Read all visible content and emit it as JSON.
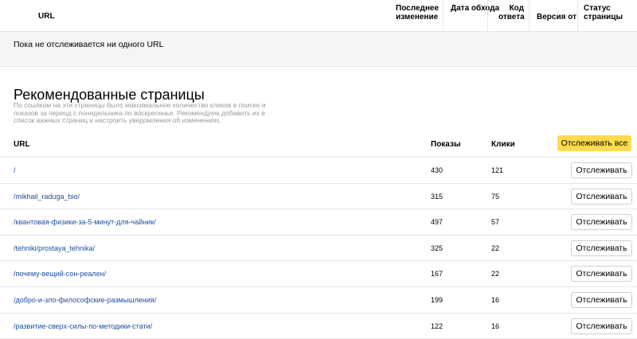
{
  "tracked_table": {
    "columns": {
      "url": "URL",
      "last_change": "Последнее изменение",
      "crawl_date": "Дата обхода",
      "response_code": "Код ответа",
      "version_from": "Версия от",
      "page_status": "Статус страницы"
    },
    "empty_message": "Пока не отслеживается ни одного URL"
  },
  "recommended": {
    "title": "Рекомендованные страницы",
    "description": "По ссылкам на эти страницы было максимальное количество кликов в поиске и показов за период с понедельника по воскресенье. Рекомендуем добавить их в список важных страниц и настроить уведомления об изменениях.",
    "columns": {
      "url": "URL",
      "shows": "Показы",
      "clicks": "Клики"
    },
    "track_all_label": "Отслеживать все",
    "track_label": "Отслеживать",
    "rows": [
      {
        "url": "/",
        "shows": "430",
        "clicks": "121"
      },
      {
        "url": "/mikhail_raduga_bio/",
        "shows": "315",
        "clicks": "75"
      },
      {
        "url": "/квантовая-физики-за-5-минут-для-чайник/",
        "shows": "497",
        "clicks": "57"
      },
      {
        "url": "/tehniki/prostaya_tehnika/",
        "shows": "325",
        "clicks": "22"
      },
      {
        "url": "/почему-вещий-сон-реален/",
        "shows": "167",
        "clicks": "22"
      },
      {
        "url": "/добро-и-зло-философские-размышления/",
        "shows": "199",
        "clicks": "16"
      },
      {
        "url": "/развитие-сверх-силы-по-методики-стати/",
        "shows": "122",
        "clicks": "16"
      }
    ]
  },
  "colors": {
    "accent_button": "#ffdb4d",
    "link": "#1f4fa0",
    "muted_text": "#999999"
  }
}
